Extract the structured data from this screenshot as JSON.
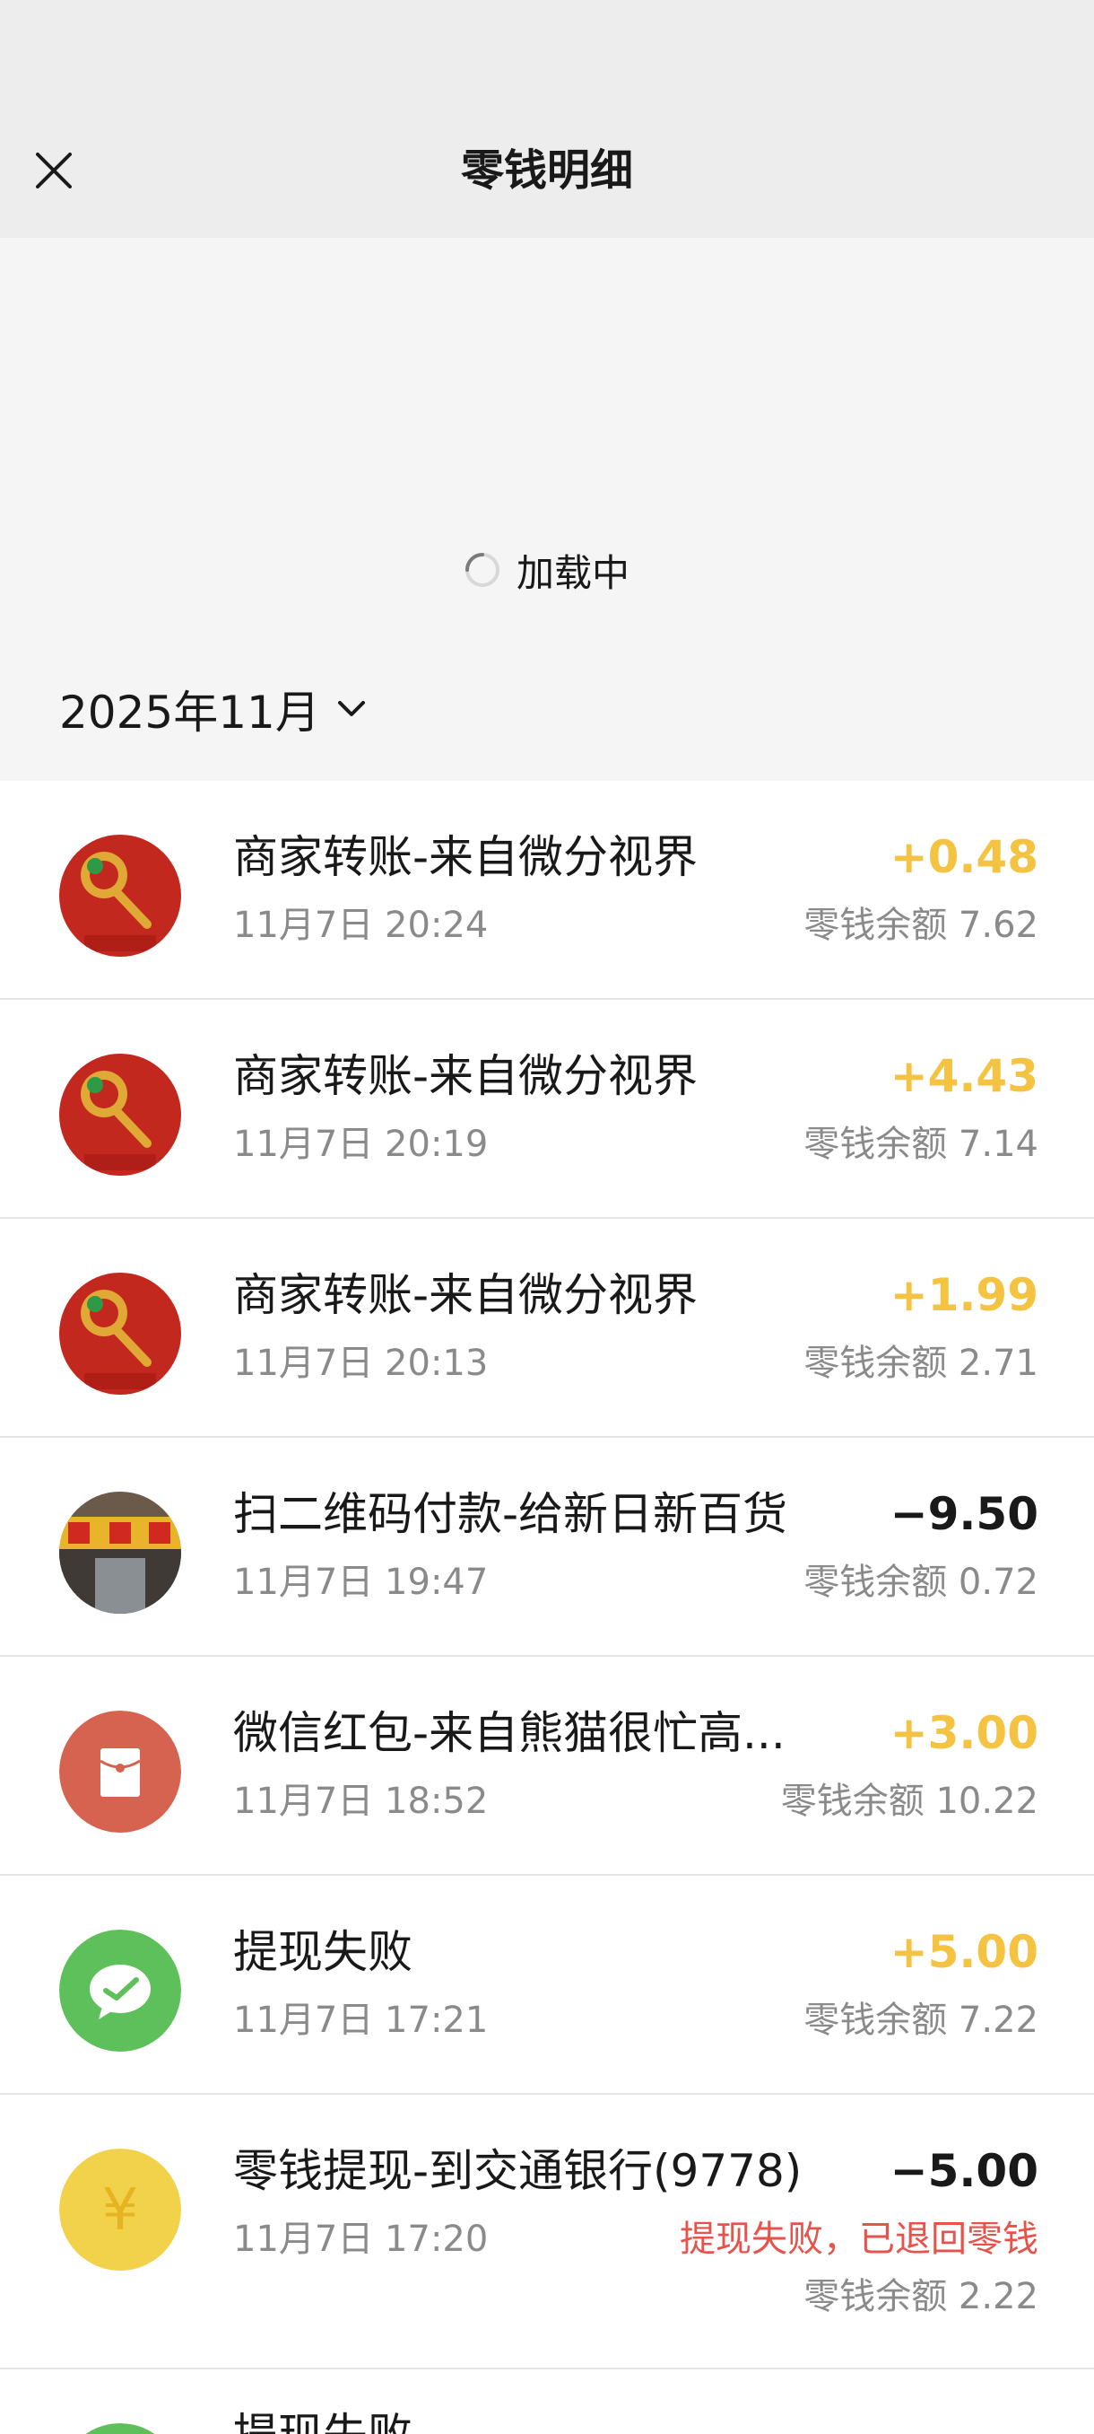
{
  "header": {
    "title": "零钱明细",
    "close_icon": "close-icon"
  },
  "loading": {
    "text": "加载中"
  },
  "month": {
    "label": "2025年11月"
  },
  "transactions": [
    {
      "title": "商家转账-来自微分视界",
      "time": "11月7日 20:24",
      "amount": "+0.48",
      "balance": "零钱余额 7.62",
      "icon": "merchant-avatar",
      "sign": "positive"
    },
    {
      "title": "商家转账-来自微分视界",
      "time": "11月7日 20:19",
      "amount": "+4.43",
      "balance": "零钱余额 7.14",
      "icon": "merchant-avatar",
      "sign": "positive"
    },
    {
      "title": "商家转账-来自微分视界",
      "time": "11月7日 20:13",
      "amount": "+1.99",
      "balance": "零钱余额 2.71",
      "icon": "merchant-avatar",
      "sign": "positive"
    },
    {
      "title": "扫二维码付款-给新日新百货",
      "time": "11月7日 19:47",
      "amount": "−9.50",
      "balance": "零钱余额 0.72",
      "icon": "store-avatar",
      "sign": "negative"
    },
    {
      "title": "微信红包-来自熊猫很忙高...",
      "time": "11月7日 18:52",
      "amount": "+3.00",
      "balance": "零钱余额 10.22",
      "icon": "red-packet-icon",
      "sign": "positive"
    },
    {
      "title": "提现失败",
      "time": "11月7日 17:21",
      "amount": "+5.00",
      "balance": "零钱余额 7.22",
      "icon": "wechat-icon",
      "sign": "positive"
    },
    {
      "title": "零钱提现-到交通银行(9778)",
      "time": "11月7日 17:20",
      "amount": "−5.00",
      "note": "提现失败，已退回零钱",
      "balance": "零钱余额 2.22",
      "icon": "yuan-coin-icon",
      "sign": "negative"
    },
    {
      "title": "提现失败",
      "icon": "wechat-icon"
    }
  ],
  "colors": {
    "positive": "#f5c342",
    "negative": "#191919",
    "note": "#e5534b",
    "header_bg": "#ededed"
  }
}
